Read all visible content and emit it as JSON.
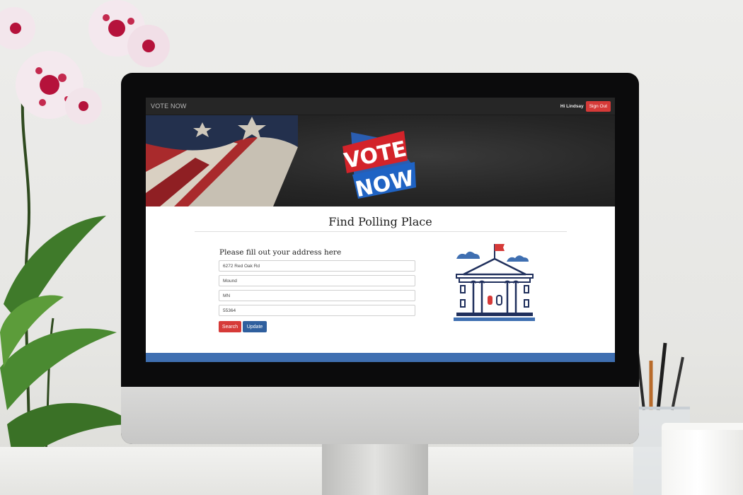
{
  "app": {
    "brand": "VOTE NOW"
  },
  "header": {
    "greeting": "Hi Lindsay",
    "signout_label": "Sign Out"
  },
  "hero": {
    "logo_line1": "VOTE",
    "logo_line2": "NOW"
  },
  "main": {
    "title": "Find Polling Place",
    "form_heading": "Please fill out your address here",
    "fields": {
      "street": "6272 Red Oak Rd",
      "city": "Mound",
      "state": "MN",
      "zip": "55364"
    },
    "search_label": "Search",
    "update_label": "Update"
  },
  "colors": {
    "accent_red": "#d63a38",
    "accent_blue": "#2f5f9e",
    "navbar": "#262626",
    "footer_bar": "#3f6fb1"
  },
  "icons": {
    "hero_image": "american-flag",
    "illustration": "capitol-building-icon"
  }
}
